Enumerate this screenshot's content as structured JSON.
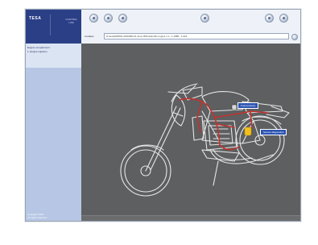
{
  "app": {
    "brand": "TESA",
    "brand_sub_line1": "CONTROL",
    "brand_sub_line2": "LINK"
  },
  "toolbar": {
    "buttons": [
      "back-icon",
      "forward-icon",
      "home-icon",
      "tools-icon",
      "zoom-in-icon",
      "zoom-out-icon"
    ]
  },
  "location": {
    "label": "Location:",
    "value": "D:\\tesa\\MPD02 2016\\MD-01 Zone B\\Position\\ID engine 1.1 - 1.1886 - 1.001"
  },
  "sidebar": {
    "items": [
      {
        "label": "Engine compartment"
      },
      {
        "label": "1. Engine injection"
      }
    ],
    "footer_line1": "Copyright 2004",
    "footer_line2": "All rights reserved"
  },
  "diagram": {
    "callouts": [
      {
        "label": "Fuel pressure"
      },
      {
        "label": "Sensor diagnostics"
      }
    ],
    "colors": {
      "background": "#5d5f61",
      "outline": "#e8e8e8",
      "harness": "#c0332e",
      "highlight": "#f2c01e"
    }
  }
}
